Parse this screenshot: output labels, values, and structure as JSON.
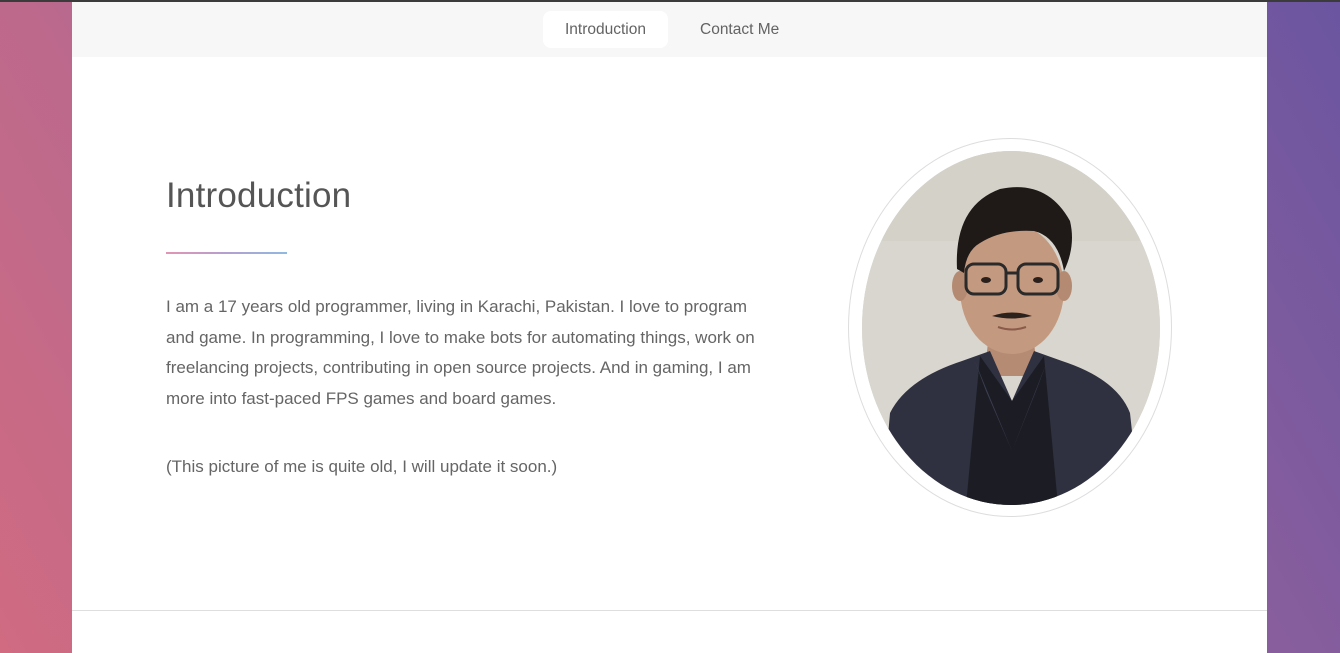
{
  "nav": {
    "items": [
      {
        "label": "Introduction",
        "active": true
      },
      {
        "label": "Contact Me",
        "active": false
      }
    ]
  },
  "intro": {
    "title": "Introduction",
    "paragraphs": [
      "I am a 17 years old programmer, living in Karachi, Pakistan. I love to program and game. In programming, I love to make bots for automating things, work on freelancing projects, contributing in open source projects. And in gaming, I am more into fast-paced FPS games and board games.",
      "(This picture of me is quite old, I will update it soon.)"
    ]
  },
  "colors": {
    "bg_left": "#d06b81",
    "bg_right": "#6b55a0",
    "nav_bg": "#f7f7f7",
    "text": "#656565"
  },
  "icons": {
    "profile_photo": "portrait-photo"
  }
}
